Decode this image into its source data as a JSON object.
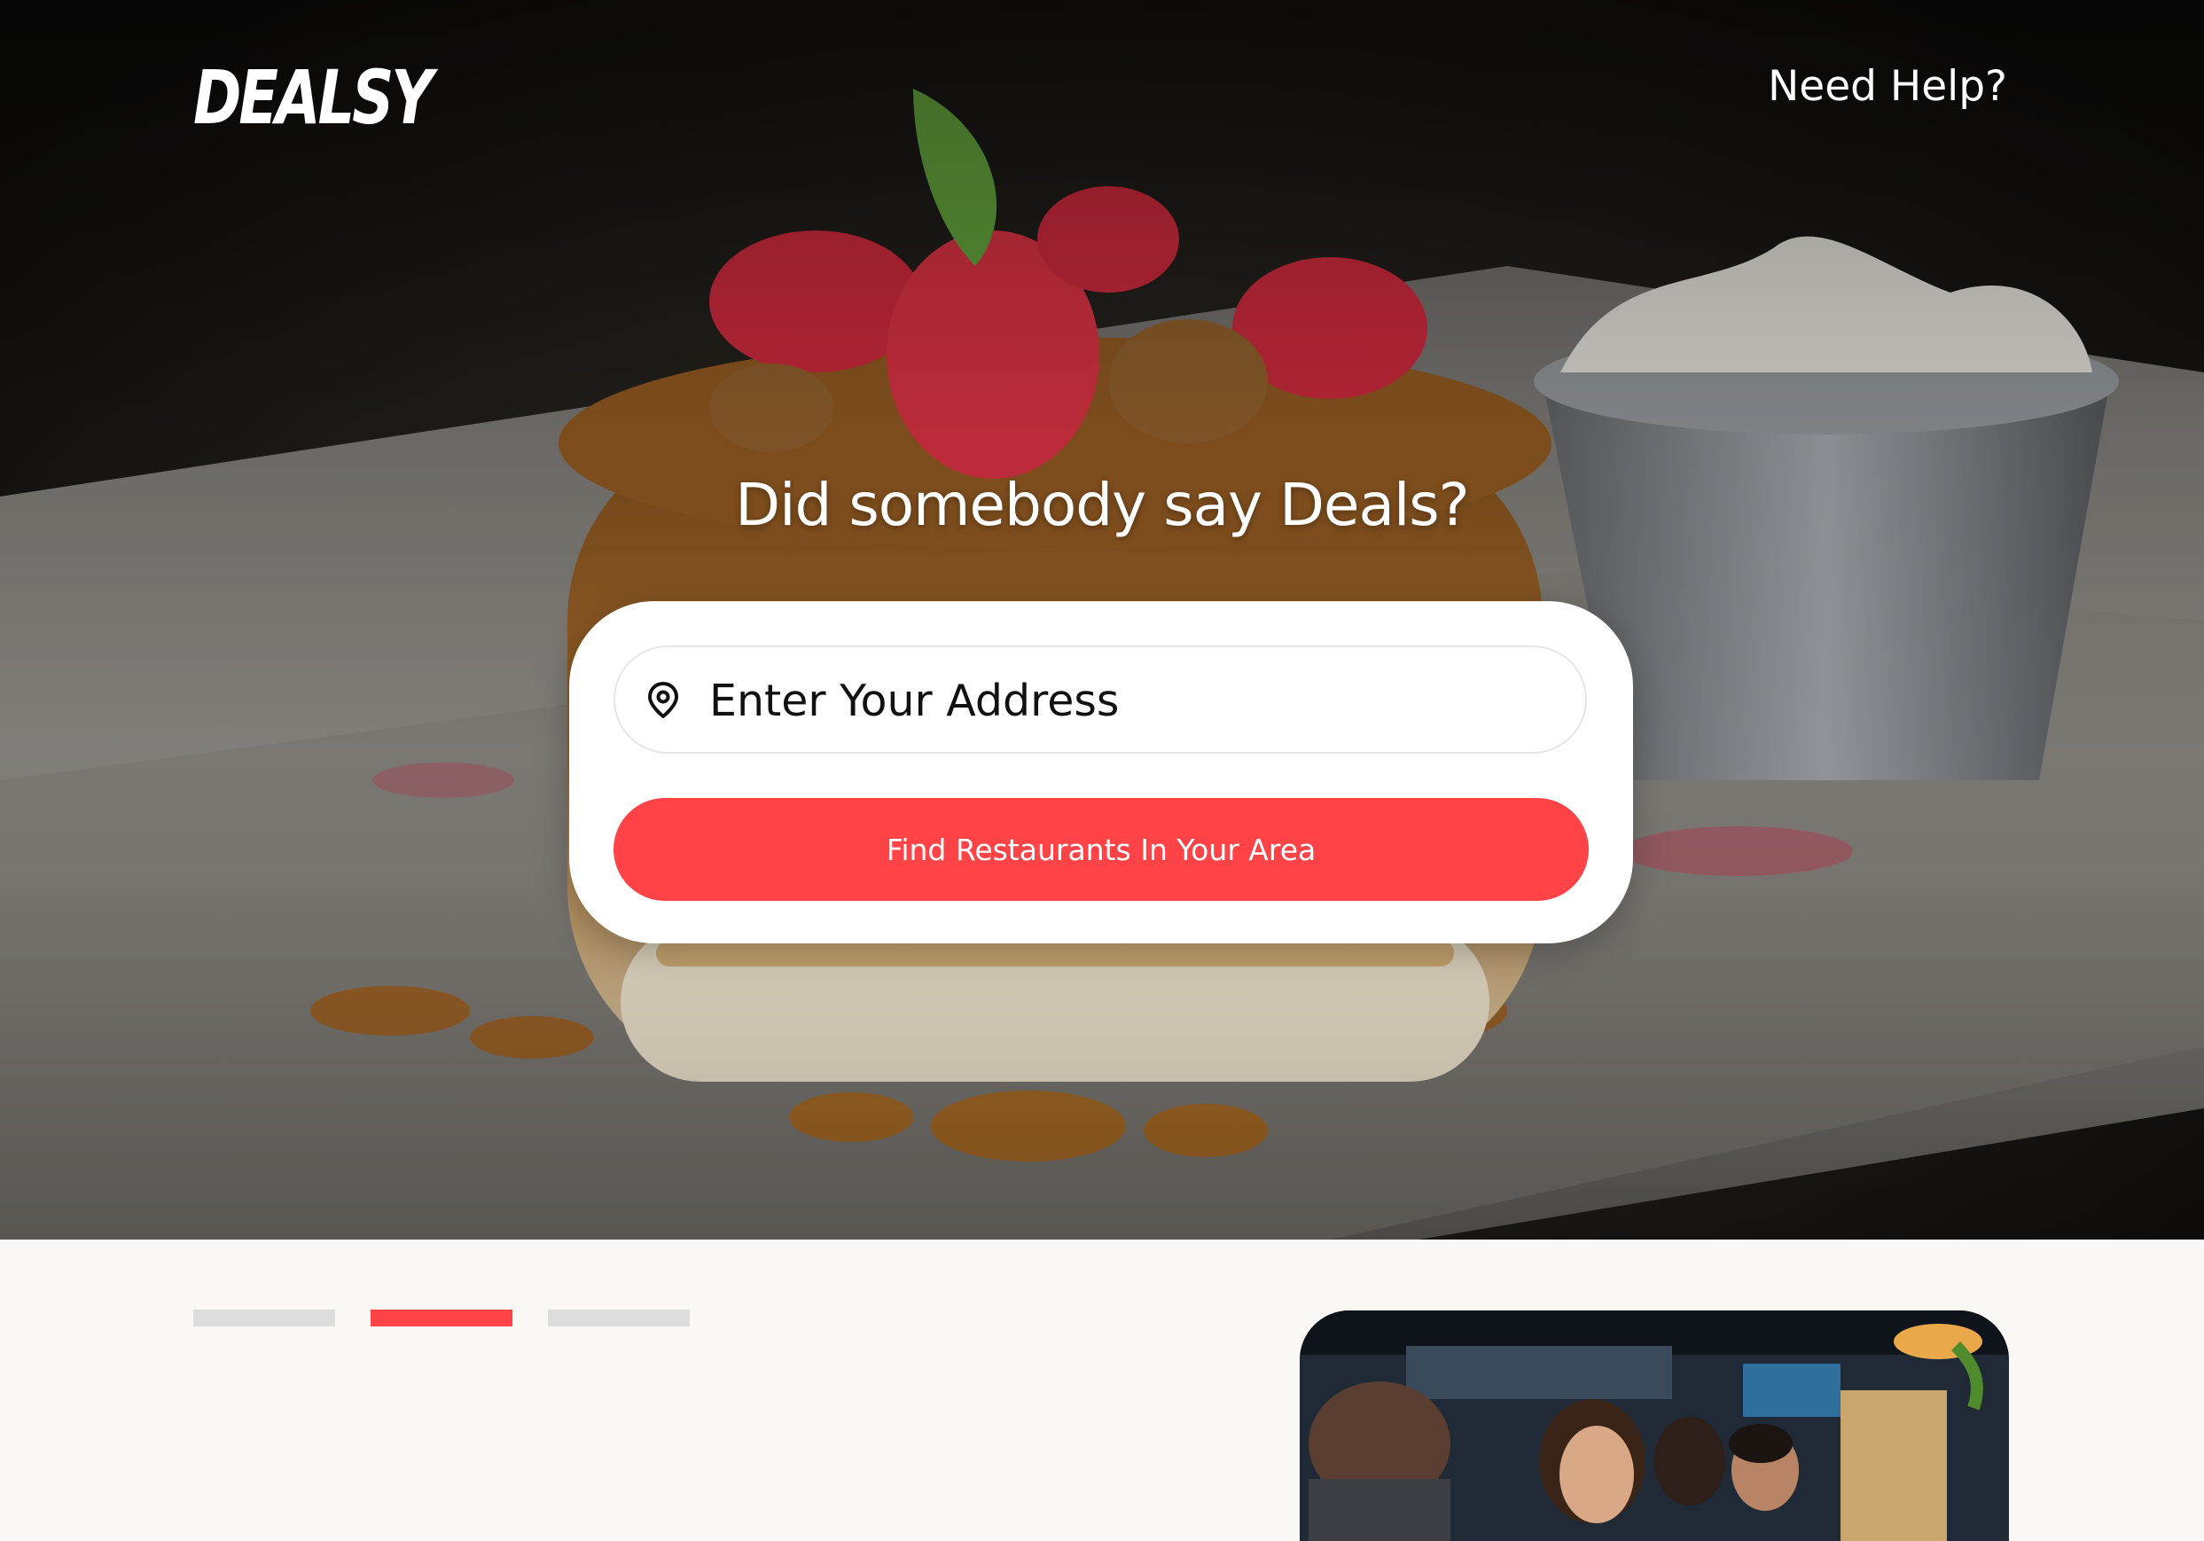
{
  "header": {
    "logo_text": "DEALSY",
    "help_label": "Need Help?"
  },
  "hero": {
    "headline": "Did somebody say Deals?",
    "address_placeholder": "Enter Your Address",
    "find_button_label": "Find Restaurants In Your Area",
    "background_image": "pancake-dessert-photo"
  },
  "carousel": {
    "indicators": [
      {
        "active": false
      },
      {
        "active": true
      },
      {
        "active": false
      }
    ],
    "image": "restaurant-people-photo"
  },
  "colors": {
    "accent": "#ff4347",
    "indicator_inactive": "#dcdcdc",
    "page_background": "#faf8f4"
  },
  "icons": {
    "address": "location-pin-icon"
  }
}
